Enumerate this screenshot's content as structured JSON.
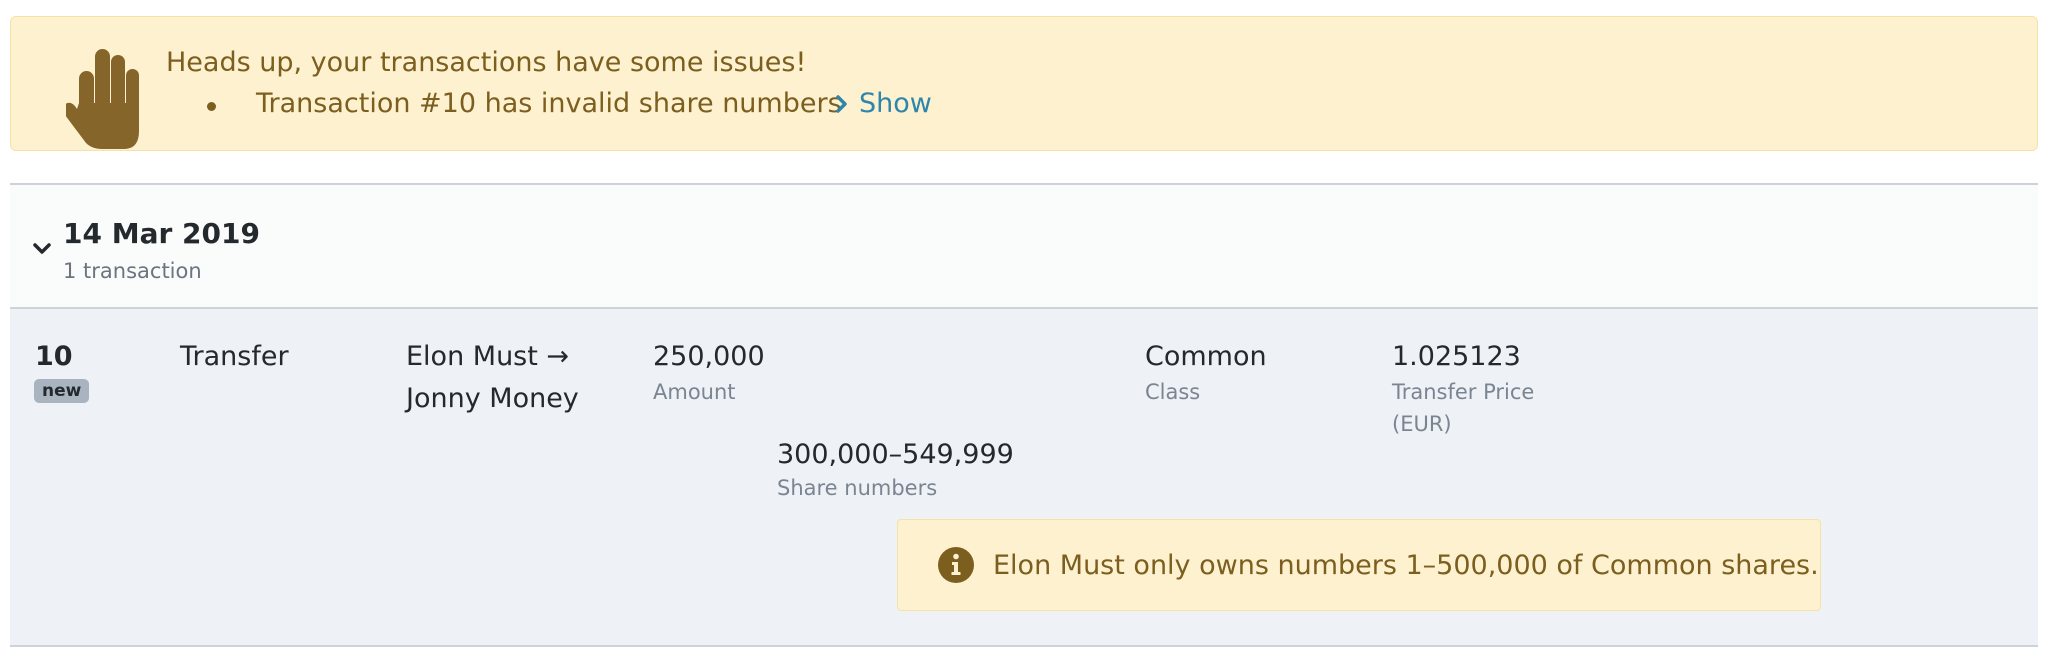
{
  "alert": {
    "icon": "hand-icon",
    "title": "Heads up, your transactions have some issues!",
    "issues": [
      {
        "text": "Transaction #10 has invalid share numbers",
        "link_icon": "chevron-right-icon",
        "link_label": "Show"
      }
    ],
    "colors": {
      "background": "#fdf1cf",
      "text": "#7c5e1f",
      "link": "#2e86ab"
    }
  },
  "group": {
    "toggle_icon": "chevron-down-icon",
    "date": "14 Mar 2019",
    "count_label": "1 transaction"
  },
  "transaction": {
    "id": "10",
    "badge": "new",
    "type": "Transfer",
    "parties": {
      "from": "Elon Must →",
      "to": "Jonny Money"
    },
    "amount": {
      "value": "250,000",
      "label": "Amount"
    },
    "share_numbers": {
      "value": "300,000–549,999",
      "label": "Share numbers"
    },
    "class": {
      "value": "Common",
      "label": "Class"
    },
    "transfer_price": {
      "value": "1.025123",
      "label_line1": "Transfer Price",
      "label_line2": "(EUR)"
    },
    "warning": {
      "icon": "info-icon",
      "text": "Elon Must only owns numbers 1–500,000 of Common shares."
    }
  }
}
